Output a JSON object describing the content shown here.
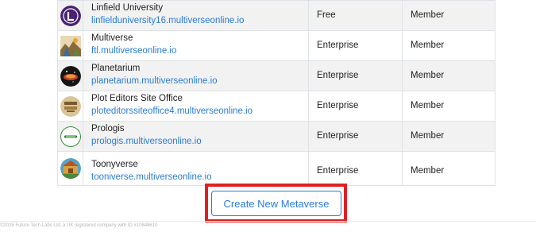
{
  "metaverses": [
    {
      "name": "Linfield University",
      "domain": "linfielduniversity16.multiverseonline.io",
      "plan": "Free",
      "role": "Member",
      "logo_icon": "linfield-logo-icon"
    },
    {
      "name": "Multiverse",
      "domain": "ftl.multiverseonline.io",
      "plan": "Enterprise",
      "role": "Member",
      "logo_icon": "multiverse-logo-icon"
    },
    {
      "name": "Planetarium",
      "domain": "planetarium.multiverseonline.io",
      "plan": "Enterprise",
      "role": "Member",
      "logo_icon": "planetarium-logo-icon"
    },
    {
      "name": "Plot Editors Site Office",
      "domain": "ploteditorssiteoffice4.multiverseonline.io",
      "plan": "Enterprise",
      "role": "Member",
      "logo_icon": "plot-editors-logo-icon"
    },
    {
      "name": "Prologis",
      "domain": "prologis.multiverseonline.io",
      "plan": "Enterprise",
      "role": "Member",
      "logo_icon": "prologis-logo-icon"
    },
    {
      "name": "Toonyverse",
      "domain": "tooniverse.multiverseonline.io",
      "plan": "Enterprise",
      "role": "Member",
      "logo_icon": "toonyverse-logo-icon"
    }
  ],
  "create_button_label": "Create New Metaverse",
  "footer": {
    "text": "©2025 Future Tech Labs Ltd, a UK registered company with ID #10848610"
  },
  "colors": {
    "link": "#2b7bd6",
    "highlight": "#e02020",
    "row_stripe": "#f2f2f2",
    "border": "#dee2e6"
  }
}
